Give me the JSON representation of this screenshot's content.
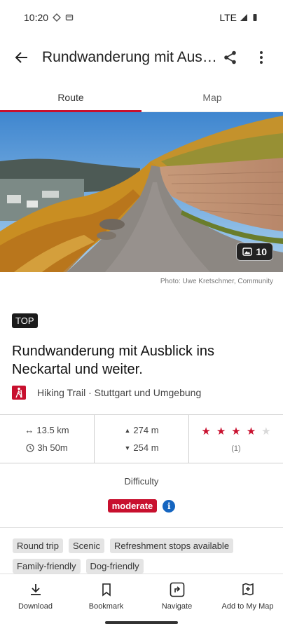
{
  "status_bar": {
    "time": "10:20",
    "network": "LTE"
  },
  "app_bar": {
    "title": "Rundwanderung mit Ausblick ins Neckartal und weiter."
  },
  "tabs": [
    {
      "label": "Route",
      "active": true
    },
    {
      "label": "Map",
      "active": false
    }
  ],
  "hero": {
    "photo_count": "10",
    "credit": "Photo: Uwe Kretschmer, Community"
  },
  "badge": "TOP",
  "route": {
    "title": "Rundwanderung mit Ausblick ins Neckartal und weiter.",
    "category": "Hiking Trail · Stuttgart und Umgebung"
  },
  "stats": {
    "distance": "13.5 km",
    "duration": "3h 50m",
    "ascent": "274 m",
    "descent": "254 m",
    "rating": 4,
    "rating_max": 5,
    "rating_count": "(1)"
  },
  "difficulty": {
    "label": "Difficulty",
    "value": "moderate"
  },
  "tags": [
    "Round trip",
    "Scenic",
    "Refreshment stops available",
    "Family-friendly",
    "Dog-friendly"
  ],
  "bottom_nav": [
    {
      "label": "Download",
      "icon": "download-icon"
    },
    {
      "label": "Bookmark",
      "icon": "bookmark-icon"
    },
    {
      "label": "Navigate",
      "icon": "navigate-icon"
    },
    {
      "label": "Add to My Map",
      "icon": "add-to-map-icon"
    }
  ],
  "colors": {
    "accent": "#c8102e",
    "info": "#1565c0"
  }
}
